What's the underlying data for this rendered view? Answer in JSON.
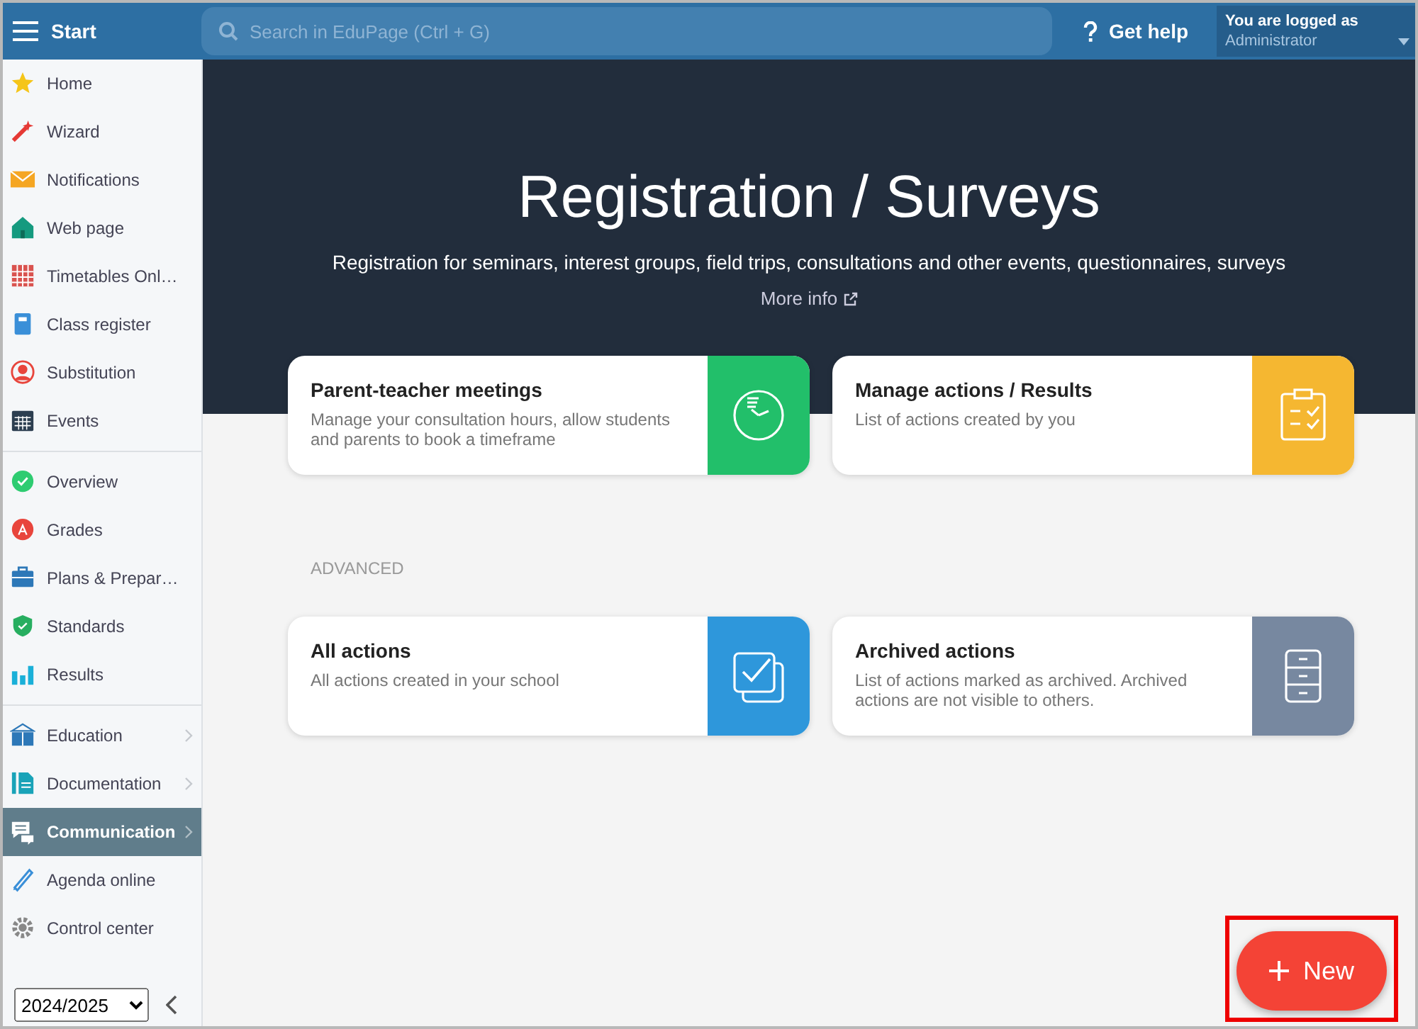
{
  "header": {
    "title": "Start",
    "search": {
      "placeholder": "Search in EduPage (Ctrl + G)"
    },
    "help": "Get help",
    "user": {
      "caption": "You are logged as",
      "name": "Administrator"
    }
  },
  "sidebar": {
    "groups": [
      [
        {
          "label": "Home",
          "selected": false,
          "submenu": false
        },
        {
          "label": "Wizard",
          "selected": false,
          "submenu": false
        },
        {
          "label": "Notifications",
          "selected": false,
          "submenu": false
        },
        {
          "label": "Web page",
          "selected": false,
          "submenu": false
        },
        {
          "label": "Timetables Onl…",
          "selected": false,
          "submenu": false
        },
        {
          "label": "Class register",
          "selected": false,
          "submenu": false
        },
        {
          "label": "Substitution",
          "selected": false,
          "submenu": false
        },
        {
          "label": "Events",
          "selected": false,
          "submenu": false
        }
      ],
      [
        {
          "label": "Overview",
          "selected": false,
          "submenu": false
        },
        {
          "label": "Grades",
          "selected": false,
          "submenu": false
        },
        {
          "label": "Plans & Prepar…",
          "selected": false,
          "submenu": false
        },
        {
          "label": "Standards",
          "selected": false,
          "submenu": false
        },
        {
          "label": "Results",
          "selected": false,
          "submenu": false
        }
      ],
      [
        {
          "label": "Education",
          "selected": false,
          "submenu": true
        },
        {
          "label": "Documentation",
          "selected": false,
          "submenu": true
        },
        {
          "label": "Communication",
          "selected": true,
          "submenu": true
        },
        {
          "label": "Agenda online",
          "selected": false,
          "submenu": false
        },
        {
          "label": "Control center",
          "selected": false,
          "submenu": false
        }
      ]
    ],
    "year": "2024/2025"
  },
  "hero": {
    "title": "Registration / Surveys",
    "subtitle": "Registration for seminars, interest groups, field trips, consultations and other events, questionnaires, surveys",
    "link": "More info"
  },
  "cards": [
    {
      "title": "Parent-teacher meetings",
      "text": "Manage your consultation hours, allow students and parents to book a timeframe",
      "color": "#22bf6a"
    },
    {
      "title": "Manage actions / Results",
      "text": "List of actions created by you",
      "color": "#f5b731"
    }
  ],
  "advanced": {
    "heading": "ADVANCED",
    "cards": [
      {
        "title": "All actions",
        "text": "All actions created in your school",
        "color": "#2e97db"
      },
      {
        "title": "Archived actions",
        "text": "List of actions marked as archived. Archived actions are not visible to others.",
        "color": "#7788a0"
      }
    ]
  },
  "new_button": "New"
}
